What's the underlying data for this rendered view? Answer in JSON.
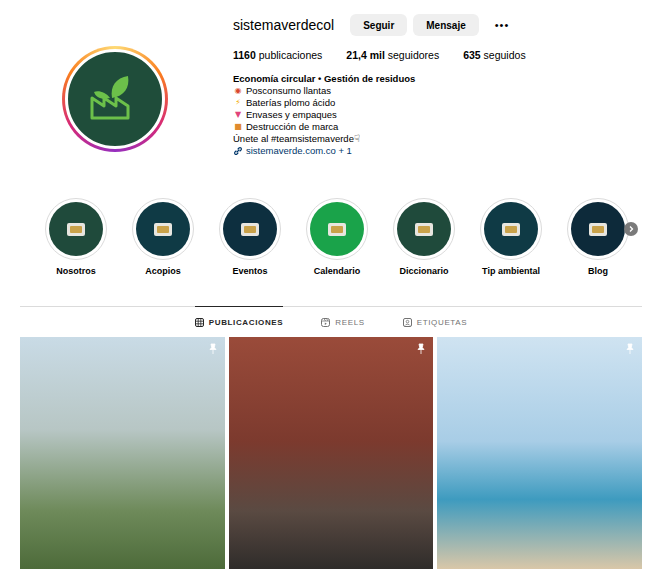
{
  "profile": {
    "username": "sistemaverdecol",
    "buttons": [
      {
        "label": "Seguir"
      },
      {
        "label": "Mensaje"
      }
    ],
    "more": "•••",
    "stats": [
      {
        "value": "1160",
        "label": "publicaciones"
      },
      {
        "value": "21,4 mil",
        "label": "seguidores"
      },
      {
        "value": "635",
        "label": "seguidos"
      }
    ],
    "bio": {
      "category": "Economía circular • Gestión de residuos",
      "lines": [
        {
          "icon": "◉",
          "text": "Posconsumo llantas",
          "color": "#d9482b"
        },
        {
          "icon": "⚡",
          "text": "Baterías plomo ácido",
          "color": "#f2a900"
        },
        {
          "icon": "▼",
          "text": "Envases y empaques",
          "color": "#e0457b"
        },
        {
          "icon": "■",
          "text": "Destrucción de marca",
          "color": "#e08a2e"
        }
      ],
      "tagline": "Únete al #teamsistemaverde☟",
      "link": "sistemaverde.com.co + 1"
    }
  },
  "highlights": [
    {
      "label": "Nosotros",
      "color": "#1f4a3b"
    },
    {
      "label": "Acopios",
      "color": "#0f3a45"
    },
    {
      "label": "Eventos",
      "color": "#0d2f3f"
    },
    {
      "label": "Calendario",
      "color": "#1aa34a"
    },
    {
      "label": "Diccionario",
      "color": "#1f4a3b"
    },
    {
      "label": "Tip ambiental",
      "color": "#0f3a45"
    },
    {
      "label": "Blog",
      "color": "#0d2a3a"
    }
  ],
  "tabs": [
    {
      "label": "PUBLICACIONES",
      "selected": true
    },
    {
      "label": "REELS",
      "selected": false
    },
    {
      "label": "ETIQUETAS",
      "selected": false
    }
  ],
  "posts": [
    {
      "pinned": true
    },
    {
      "pinned": true
    },
    {
      "pinned": true
    }
  ]
}
